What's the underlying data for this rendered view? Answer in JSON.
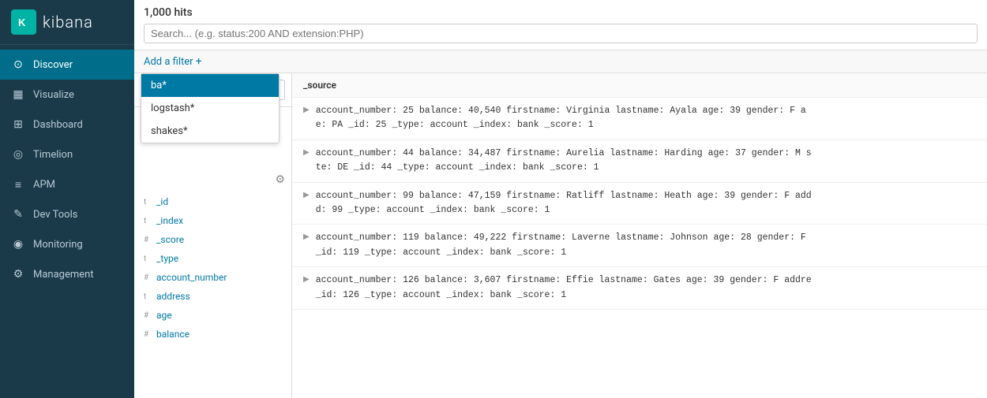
{
  "sidebar": {
    "logo": {
      "icon": "k",
      "text": "kibana"
    },
    "items": [
      {
        "id": "discover",
        "label": "Discover",
        "icon": "⊙",
        "active": true
      },
      {
        "id": "visualize",
        "label": "Visualize",
        "icon": "▦",
        "active": false
      },
      {
        "id": "dashboard",
        "label": "Dashboard",
        "icon": "⊞",
        "active": false
      },
      {
        "id": "timelion",
        "label": "Timelion",
        "icon": "◎",
        "active": false
      },
      {
        "id": "apm",
        "label": "APM",
        "icon": "≡",
        "active": false
      },
      {
        "id": "devtools",
        "label": "Dev Tools",
        "icon": "✎",
        "active": false
      },
      {
        "id": "monitoring",
        "label": "Monitoring",
        "icon": "◉",
        "active": false
      },
      {
        "id": "management",
        "label": "Management",
        "icon": "⚙",
        "active": false
      }
    ]
  },
  "topbar": {
    "hits": "1,000 hits",
    "search_placeholder": "Search... (e.g. status:200 AND extension:PHP)"
  },
  "filter_bar": {
    "add_filter_label": "Add a filter"
  },
  "left_panel": {
    "search_placeholder": "",
    "dropdown": {
      "items": [
        {
          "label": "ba*",
          "selected": true
        },
        {
          "label": "logstash*",
          "selected": false
        },
        {
          "label": "shakes*",
          "selected": false
        }
      ]
    },
    "fields": [
      {
        "type": "t",
        "name": "_id"
      },
      {
        "type": "t",
        "name": "_index"
      },
      {
        "type": "#",
        "name": "_score"
      },
      {
        "type": "t",
        "name": "_type"
      },
      {
        "type": "#",
        "name": "account_number"
      },
      {
        "type": "t",
        "name": "address"
      },
      {
        "type": "#",
        "name": "age"
      },
      {
        "type": "#",
        "name": "balance"
      }
    ]
  },
  "results": {
    "header": "_source",
    "rows": [
      {
        "line1": "account_number: 25  balance: 40,540  firstname: Virginia  lastname: Ayala  age: 39  gender: F  a",
        "line2": "e: PA  _id: 25  _type: account  _index: bank  _score: 1"
      },
      {
        "line1": "account_number: 44  balance: 34,487  firstname: Aurelia  lastname: Harding  age: 37  gender: M  s",
        "line2": "te: DE  _id: 44  _type: account  _index: bank  _score: 1"
      },
      {
        "line1": "account_number: 99  balance: 47,159  firstname: Ratliff  lastname: Heath  age: 39  gender: F  add",
        "line2": "d: 99  _type: account  _index: bank  _score: 1"
      },
      {
        "line1": "account_number: 119  balance: 49,222  firstname: Laverne  lastname: Johnson  age: 28  gender: F",
        "line2": "_id: 119  _type: account  _index: bank  _score: 1"
      },
      {
        "line1": "account_number: 126  balance: 3,607  firstname: Effie  lastname: Gates  age: 39  gender: F  addre",
        "line2": "_id: 126  _type: account  _index: bank  _score: 1"
      }
    ]
  }
}
